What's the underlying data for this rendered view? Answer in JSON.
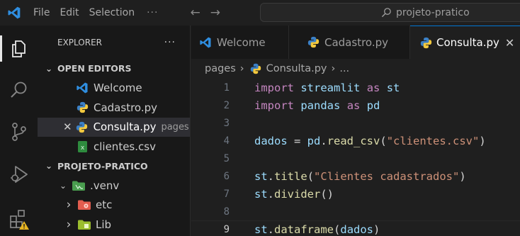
{
  "titlebar": {
    "menus": [
      "File",
      "Edit",
      "Selection"
    ],
    "more": "···",
    "back_arrow": "←",
    "forward_arrow": "→",
    "search_text": "projeto-pratico"
  },
  "explorer": {
    "title": "EXPLORER",
    "more": "···",
    "open_editors_label": "OPEN EDITORS",
    "open_editors": [
      {
        "name": "Welcome",
        "icon": "vscode-icon"
      },
      {
        "name": "Cadastro.py",
        "icon": "python-icon"
      },
      {
        "name": "Consulta.py",
        "icon": "python-icon",
        "hint": "pages",
        "selected": true
      },
      {
        "name": "clientes.csv",
        "icon": "csv-icon"
      }
    ],
    "project_label": "PROJETO-PRATICO",
    "tree": [
      {
        "name": ".venv",
        "icon": "folder-venv-icon",
        "expanded": true
      },
      {
        "name": "etc",
        "icon": "folder-etc-icon",
        "expanded": false
      },
      {
        "name": "Lib",
        "icon": "folder-lib-icon",
        "expanded": false
      }
    ],
    "chevron_down": "⌄",
    "chevron_right": "›",
    "close_glyph": "✕"
  },
  "tabs": [
    {
      "label": "Welcome",
      "icon": "vscode-icon"
    },
    {
      "label": "Cadastro.py",
      "icon": "python-icon"
    },
    {
      "label": "Consulta.py",
      "icon": "python-icon",
      "active": true
    }
  ],
  "tab_close": "✕",
  "breadcrumb": {
    "folder": "pages",
    "file": "Consulta.py",
    "tail": "..."
  },
  "editor": {
    "current_line": 9,
    "lines": [
      {
        "n": "1",
        "tokens": [
          [
            "kw",
            "import"
          ],
          [
            "op",
            " "
          ],
          [
            "id",
            "streamlit"
          ],
          [
            "op",
            " "
          ],
          [
            "kw",
            "as"
          ],
          [
            "op",
            " "
          ],
          [
            "id",
            "st"
          ]
        ]
      },
      {
        "n": "2",
        "tokens": [
          [
            "kw",
            "import"
          ],
          [
            "op",
            " "
          ],
          [
            "id",
            "pandas"
          ],
          [
            "op",
            " "
          ],
          [
            "kw",
            "as"
          ],
          [
            "op",
            " "
          ],
          [
            "id",
            "pd"
          ]
        ]
      },
      {
        "n": "3",
        "tokens": []
      },
      {
        "n": "4",
        "tokens": [
          [
            "id",
            "dados"
          ],
          [
            "op",
            " = "
          ],
          [
            "id",
            "pd"
          ],
          [
            "op",
            "."
          ],
          [
            "fn",
            "read_csv"
          ],
          [
            "op",
            "("
          ],
          [
            "str",
            "\"clientes.csv\""
          ],
          [
            "op",
            ")"
          ]
        ]
      },
      {
        "n": "5",
        "tokens": []
      },
      {
        "n": "6",
        "tokens": [
          [
            "id",
            "st"
          ],
          [
            "op",
            "."
          ],
          [
            "fn",
            "title"
          ],
          [
            "op",
            "("
          ],
          [
            "str",
            "\"Clientes cadastrados\""
          ],
          [
            "op",
            ")"
          ]
        ]
      },
      {
        "n": "7",
        "tokens": [
          [
            "id",
            "st"
          ],
          [
            "op",
            "."
          ],
          [
            "fn",
            "divider"
          ],
          [
            "op",
            "()"
          ]
        ]
      },
      {
        "n": "8",
        "tokens": []
      },
      {
        "n": "9",
        "tokens": [
          [
            "id",
            "st"
          ],
          [
            "op",
            "."
          ],
          [
            "fn",
            "dataframe"
          ],
          [
            "op",
            "("
          ],
          [
            "id",
            "dados"
          ],
          [
            "op",
            ")"
          ]
        ]
      }
    ]
  },
  "colors": {
    "keyword": "#c586c0",
    "identifier": "#9cdcfe",
    "function": "#dcdcaa",
    "string": "#ce9178",
    "accent": "#0078d4"
  }
}
